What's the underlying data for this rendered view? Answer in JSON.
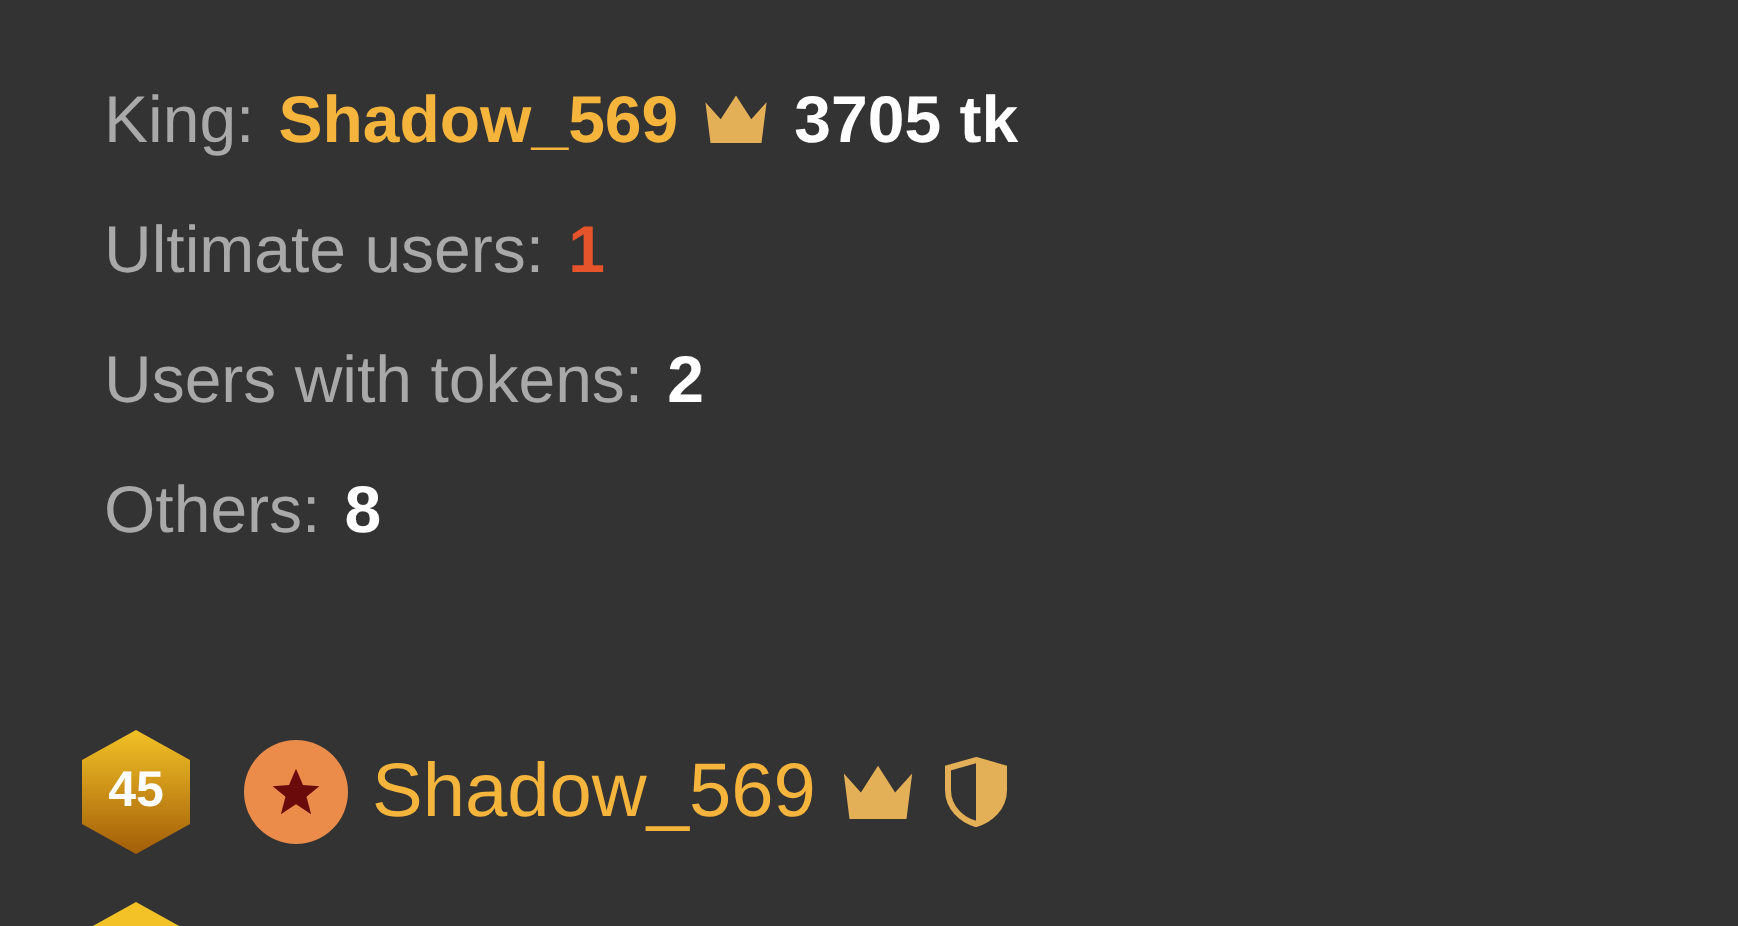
{
  "stats": [
    {
      "label": "King:",
      "value": "Shadow_569",
      "kind": "king",
      "extra": "3705 tk"
    },
    {
      "label": "Ultimate users:",
      "value": "1",
      "kind": "ultimate"
    },
    {
      "label": "Users with tokens:",
      "value": "2",
      "kind": "plain"
    },
    {
      "label": "Others:",
      "value": "8",
      "kind": "plain"
    }
  ],
  "users": [
    {
      "level": "45",
      "name": "Shadow_569",
      "king": true,
      "moderator": true
    }
  ]
}
